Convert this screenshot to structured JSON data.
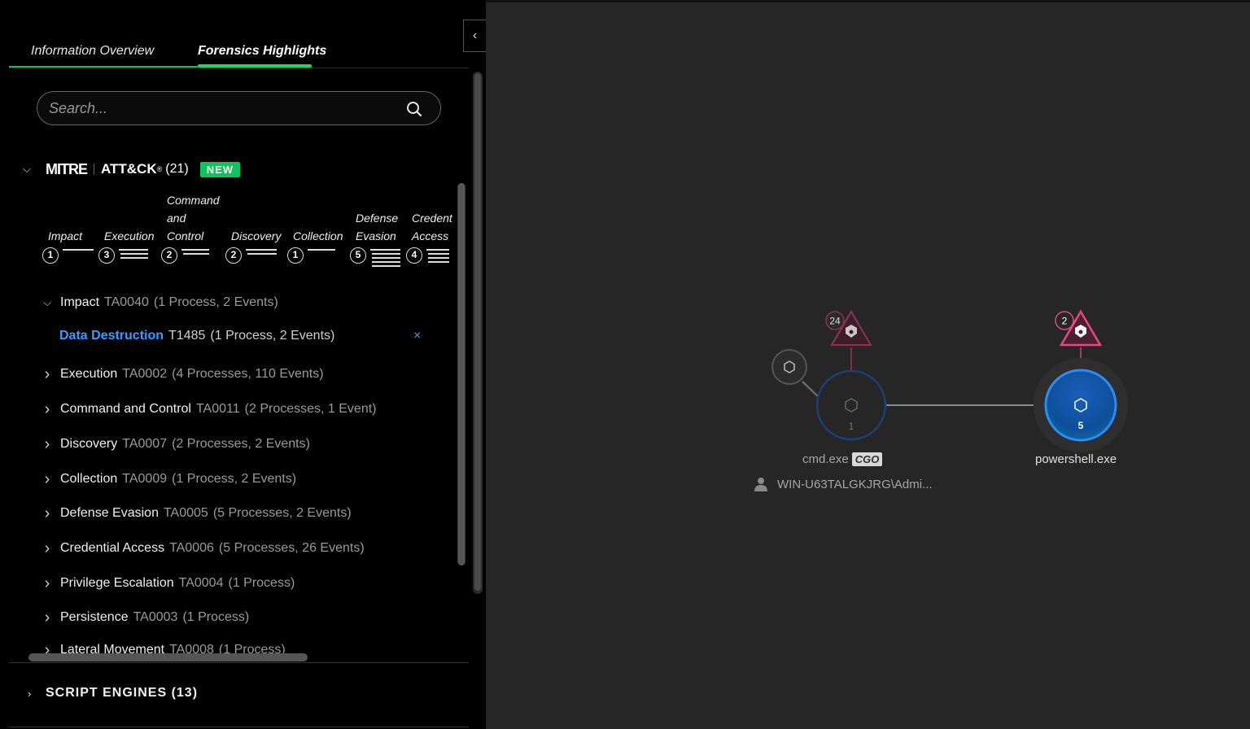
{
  "panel": {
    "collapse_icon": "chevron-left-icon",
    "tabs": [
      {
        "label": "Information Overview",
        "active": false
      },
      {
        "label": "Forensics Highlights",
        "active": true
      }
    ],
    "search": {
      "placeholder": "Search..."
    },
    "mitre": {
      "logo": "MITRE",
      "framework": "ATT&CK",
      "registered": "®",
      "count": "(21)",
      "badge": "NEW",
      "tactics": [
        {
          "lines": [
            "Impact"
          ],
          "count": "1"
        },
        {
          "lines": [
            "Execution"
          ],
          "count": "3"
        },
        {
          "lines": [
            "Command",
            "and",
            "Control"
          ],
          "count": "2"
        },
        {
          "lines": [
            "Discovery"
          ],
          "count": "2"
        },
        {
          "lines": [
            "Collection"
          ],
          "count": "1"
        },
        {
          "lines": [
            "Defense",
            "Evasion"
          ],
          "count": "5"
        },
        {
          "lines": [
            "Credent",
            "Access"
          ],
          "count": "4"
        }
      ],
      "list": [
        {
          "name": "Impact",
          "code": "TA0040",
          "meta": "(1 Process, 2 Events)",
          "expanded": true
        },
        {
          "name": "Data Destruction",
          "code": "T1485",
          "meta": "(1 Process, 2 Events)",
          "technique": true,
          "close": "×"
        },
        {
          "name": "Execution",
          "code": "TA0002",
          "meta": "(4 Processes, 110 Events)"
        },
        {
          "name": "Command and Control",
          "code": "TA0011",
          "meta": "(2 Processes, 1 Event)"
        },
        {
          "name": "Discovery",
          "code": "TA0007",
          "meta": "(2 Processes, 2 Events)"
        },
        {
          "name": "Collection",
          "code": "TA0009",
          "meta": "(1 Process, 2 Events)"
        },
        {
          "name": "Defense Evasion",
          "code": "TA0005",
          "meta": "(5 Processes, 2 Events)"
        },
        {
          "name": "Credential Access",
          "code": "TA0006",
          "meta": "(5 Processes, 26 Events)"
        },
        {
          "name": "Privilege Escalation",
          "code": "TA0004",
          "meta": "(1 Process)"
        },
        {
          "name": "Persistence",
          "code": "TA0003",
          "meta": "(1 Process)"
        },
        {
          "name": "Lateral Movement",
          "code": "TA0008",
          "meta": "(1 Process)"
        }
      ]
    },
    "script_engines": {
      "label": "SCRIPT ENGINES (13)"
    }
  },
  "graph": {
    "nodes": [
      {
        "name": "cmd.exe",
        "tag": "CGO",
        "count": "1",
        "alert_count": "24",
        "user": "WIN-U63TALGKJRG\\Admi..."
      },
      {
        "name": "powershell.exe",
        "count": "5",
        "alert_count": "2"
      }
    ],
    "colors": {
      "alert_pink": "#e8487a",
      "node_blue": "#1e7ad8",
      "edge": "#8a8a8a"
    }
  }
}
